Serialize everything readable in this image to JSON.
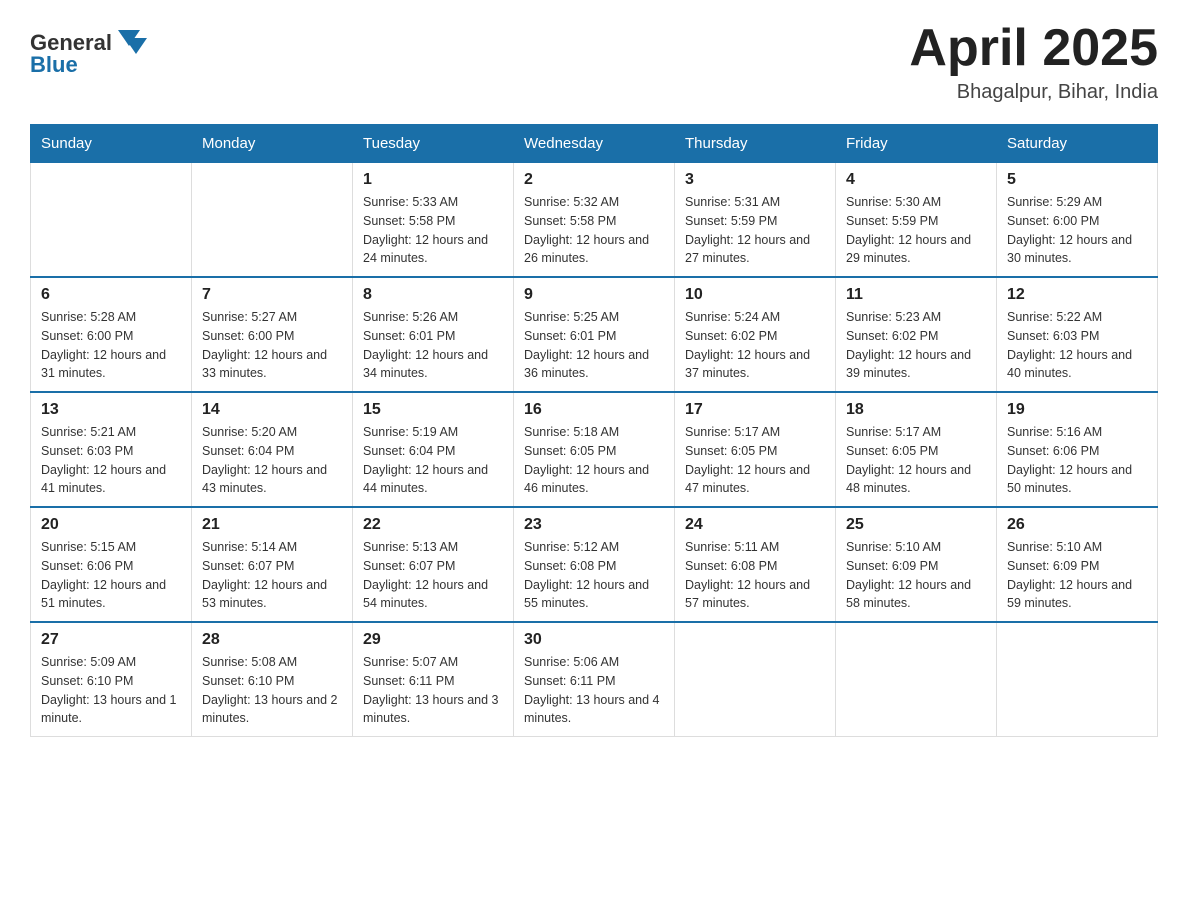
{
  "header": {
    "logo_text_black": "General",
    "logo_text_blue": "Blue",
    "month_title": "April 2025",
    "location": "Bhagalpur, Bihar, India"
  },
  "days_of_week": [
    "Sunday",
    "Monday",
    "Tuesday",
    "Wednesday",
    "Thursday",
    "Friday",
    "Saturday"
  ],
  "weeks": [
    [
      {
        "day": "",
        "sunrise": "",
        "sunset": "",
        "daylight": ""
      },
      {
        "day": "",
        "sunrise": "",
        "sunset": "",
        "daylight": ""
      },
      {
        "day": "1",
        "sunrise": "Sunrise: 5:33 AM",
        "sunset": "Sunset: 5:58 PM",
        "daylight": "Daylight: 12 hours and 24 minutes."
      },
      {
        "day": "2",
        "sunrise": "Sunrise: 5:32 AM",
        "sunset": "Sunset: 5:58 PM",
        "daylight": "Daylight: 12 hours and 26 minutes."
      },
      {
        "day": "3",
        "sunrise": "Sunrise: 5:31 AM",
        "sunset": "Sunset: 5:59 PM",
        "daylight": "Daylight: 12 hours and 27 minutes."
      },
      {
        "day": "4",
        "sunrise": "Sunrise: 5:30 AM",
        "sunset": "Sunset: 5:59 PM",
        "daylight": "Daylight: 12 hours and 29 minutes."
      },
      {
        "day": "5",
        "sunrise": "Sunrise: 5:29 AM",
        "sunset": "Sunset: 6:00 PM",
        "daylight": "Daylight: 12 hours and 30 minutes."
      }
    ],
    [
      {
        "day": "6",
        "sunrise": "Sunrise: 5:28 AM",
        "sunset": "Sunset: 6:00 PM",
        "daylight": "Daylight: 12 hours and 31 minutes."
      },
      {
        "day": "7",
        "sunrise": "Sunrise: 5:27 AM",
        "sunset": "Sunset: 6:00 PM",
        "daylight": "Daylight: 12 hours and 33 minutes."
      },
      {
        "day": "8",
        "sunrise": "Sunrise: 5:26 AM",
        "sunset": "Sunset: 6:01 PM",
        "daylight": "Daylight: 12 hours and 34 minutes."
      },
      {
        "day": "9",
        "sunrise": "Sunrise: 5:25 AM",
        "sunset": "Sunset: 6:01 PM",
        "daylight": "Daylight: 12 hours and 36 minutes."
      },
      {
        "day": "10",
        "sunrise": "Sunrise: 5:24 AM",
        "sunset": "Sunset: 6:02 PM",
        "daylight": "Daylight: 12 hours and 37 minutes."
      },
      {
        "day": "11",
        "sunrise": "Sunrise: 5:23 AM",
        "sunset": "Sunset: 6:02 PM",
        "daylight": "Daylight: 12 hours and 39 minutes."
      },
      {
        "day": "12",
        "sunrise": "Sunrise: 5:22 AM",
        "sunset": "Sunset: 6:03 PM",
        "daylight": "Daylight: 12 hours and 40 minutes."
      }
    ],
    [
      {
        "day": "13",
        "sunrise": "Sunrise: 5:21 AM",
        "sunset": "Sunset: 6:03 PM",
        "daylight": "Daylight: 12 hours and 41 minutes."
      },
      {
        "day": "14",
        "sunrise": "Sunrise: 5:20 AM",
        "sunset": "Sunset: 6:04 PM",
        "daylight": "Daylight: 12 hours and 43 minutes."
      },
      {
        "day": "15",
        "sunrise": "Sunrise: 5:19 AM",
        "sunset": "Sunset: 6:04 PM",
        "daylight": "Daylight: 12 hours and 44 minutes."
      },
      {
        "day": "16",
        "sunrise": "Sunrise: 5:18 AM",
        "sunset": "Sunset: 6:05 PM",
        "daylight": "Daylight: 12 hours and 46 minutes."
      },
      {
        "day": "17",
        "sunrise": "Sunrise: 5:17 AM",
        "sunset": "Sunset: 6:05 PM",
        "daylight": "Daylight: 12 hours and 47 minutes."
      },
      {
        "day": "18",
        "sunrise": "Sunrise: 5:17 AM",
        "sunset": "Sunset: 6:05 PM",
        "daylight": "Daylight: 12 hours and 48 minutes."
      },
      {
        "day": "19",
        "sunrise": "Sunrise: 5:16 AM",
        "sunset": "Sunset: 6:06 PM",
        "daylight": "Daylight: 12 hours and 50 minutes."
      }
    ],
    [
      {
        "day": "20",
        "sunrise": "Sunrise: 5:15 AM",
        "sunset": "Sunset: 6:06 PM",
        "daylight": "Daylight: 12 hours and 51 minutes."
      },
      {
        "day": "21",
        "sunrise": "Sunrise: 5:14 AM",
        "sunset": "Sunset: 6:07 PM",
        "daylight": "Daylight: 12 hours and 53 minutes."
      },
      {
        "day": "22",
        "sunrise": "Sunrise: 5:13 AM",
        "sunset": "Sunset: 6:07 PM",
        "daylight": "Daylight: 12 hours and 54 minutes."
      },
      {
        "day": "23",
        "sunrise": "Sunrise: 5:12 AM",
        "sunset": "Sunset: 6:08 PM",
        "daylight": "Daylight: 12 hours and 55 minutes."
      },
      {
        "day": "24",
        "sunrise": "Sunrise: 5:11 AM",
        "sunset": "Sunset: 6:08 PM",
        "daylight": "Daylight: 12 hours and 57 minutes."
      },
      {
        "day": "25",
        "sunrise": "Sunrise: 5:10 AM",
        "sunset": "Sunset: 6:09 PM",
        "daylight": "Daylight: 12 hours and 58 minutes."
      },
      {
        "day": "26",
        "sunrise": "Sunrise: 5:10 AM",
        "sunset": "Sunset: 6:09 PM",
        "daylight": "Daylight: 12 hours and 59 minutes."
      }
    ],
    [
      {
        "day": "27",
        "sunrise": "Sunrise: 5:09 AM",
        "sunset": "Sunset: 6:10 PM",
        "daylight": "Daylight: 13 hours and 1 minute."
      },
      {
        "day": "28",
        "sunrise": "Sunrise: 5:08 AM",
        "sunset": "Sunset: 6:10 PM",
        "daylight": "Daylight: 13 hours and 2 minutes."
      },
      {
        "day": "29",
        "sunrise": "Sunrise: 5:07 AM",
        "sunset": "Sunset: 6:11 PM",
        "daylight": "Daylight: 13 hours and 3 minutes."
      },
      {
        "day": "30",
        "sunrise": "Sunrise: 5:06 AM",
        "sunset": "Sunset: 6:11 PM",
        "daylight": "Daylight: 13 hours and 4 minutes."
      },
      {
        "day": "",
        "sunrise": "",
        "sunset": "",
        "daylight": ""
      },
      {
        "day": "",
        "sunrise": "",
        "sunset": "",
        "daylight": ""
      },
      {
        "day": "",
        "sunrise": "",
        "sunset": "",
        "daylight": ""
      }
    ]
  ]
}
